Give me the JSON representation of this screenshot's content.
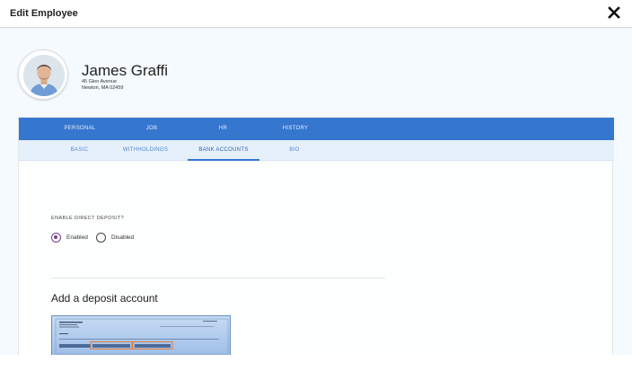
{
  "modal": {
    "title": "Edit Employee",
    "close_icon": "close-icon"
  },
  "employee": {
    "name": "James Graffi",
    "address_line1": "45 Glen Avenue",
    "address_line2": "Newton, MA 02459",
    "avatar": "avatar-photo"
  },
  "primary_tabs": [
    {
      "label": "PERSONAL",
      "active": true
    },
    {
      "label": "JOB",
      "active": false
    },
    {
      "label": "HR",
      "active": false
    },
    {
      "label": "HISTORY",
      "active": false
    }
  ],
  "secondary_tabs": [
    {
      "label": "BASIC",
      "active": false
    },
    {
      "label": "WITHHOLDINGS",
      "active": false
    },
    {
      "label": "BANK ACCOUNTS",
      "active": true
    },
    {
      "label": "BIO",
      "active": false
    }
  ],
  "direct_deposit": {
    "label": "ENABLE DIRECT DEPOSIT?",
    "options": [
      {
        "label": "Enabled",
        "selected": true
      },
      {
        "label": "Disabled",
        "selected": false
      }
    ]
  },
  "deposit_section": {
    "title": "Add a deposit account",
    "check_image": "sample-check-image"
  },
  "colors": {
    "primary_tab_bg": "#3576cf",
    "secondary_tab_bg": "#e6f0fb",
    "radio_accent": "#7a3e8e",
    "content_bg": "#f4fafd"
  }
}
